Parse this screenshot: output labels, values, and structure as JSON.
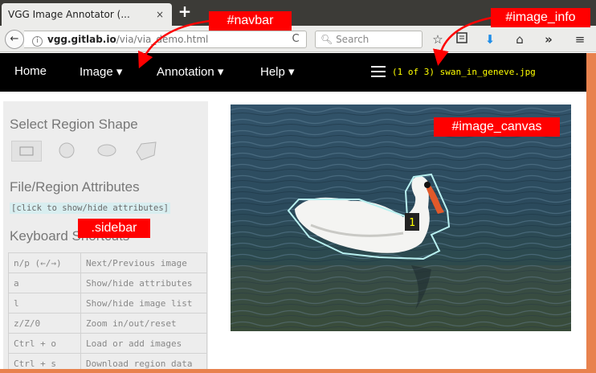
{
  "browser": {
    "tab_title": "VGG Image Annotator (...",
    "tab_close": "×",
    "new_tab": "+",
    "back": "←",
    "url_host": "vgg.gitlab.io",
    "url_path": "/via/via_demo.html",
    "reload": "C",
    "search_placeholder": "Search",
    "toolbar_icons": [
      "star-icon",
      "reading-list-icon",
      "download-icon",
      "home-icon",
      "overflow-chevron-icon",
      "menu-icon"
    ]
  },
  "navbar": {
    "items": [
      {
        "label": "Home"
      },
      {
        "label": "Image ▾"
      },
      {
        "label": "Annotation ▾"
      },
      {
        "label": "Help ▾"
      }
    ],
    "image_info": "(1 of 3) swan_in_geneve.jpg"
  },
  "sidebar": {
    "shape_heading": "Select Region Shape",
    "shapes": [
      "rectangle",
      "circle",
      "ellipse",
      "polygon"
    ],
    "attributes_heading": "File/Region Attributes",
    "attributes_toggle": "[click to show/hide attributes]",
    "keyboard_heading": "Keyboard Shortcuts",
    "shortcuts": [
      {
        "key": "n/p (←/→)",
        "action": "Next/Previous image"
      },
      {
        "key": "a",
        "action": "Show/hide attributes"
      },
      {
        "key": "l",
        "action": "Show/hide image list"
      },
      {
        "key": "z/Z/0",
        "action": "Zoom in/out/reset"
      },
      {
        "key": "Ctrl + o",
        "action": "Load or add images"
      },
      {
        "key": "Ctrl + s",
        "action": "Download region data"
      }
    ]
  },
  "canvas": {
    "region_label": "1"
  },
  "annotations": {
    "navbar": "#navbar",
    "image_info": "#image_info",
    "image_canvas": "#image_canvas",
    "sidebar": ".sidebar"
  },
  "colors": {
    "navbar_bg": "#000000",
    "image_info_text": "#ffff00",
    "annotation_tag": "#ff0000",
    "accent_stripe": "#e8824e",
    "region_outline": "#b8f0f0"
  }
}
